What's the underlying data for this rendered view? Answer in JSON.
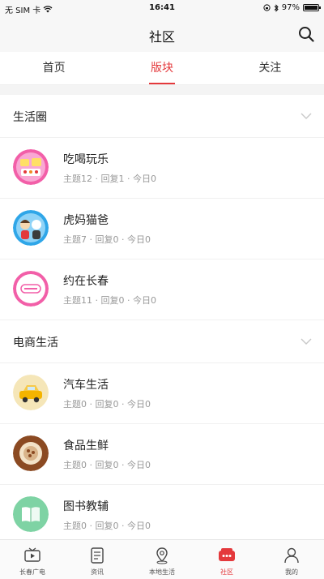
{
  "status_bar": {
    "carrier": "无 SIM 卡",
    "time": "16:41",
    "battery": "97%",
    "battery_level": 0.97
  },
  "nav": {
    "title": "社区"
  },
  "top_tabs": [
    {
      "label": "首页",
      "active": false
    },
    {
      "label": "版块",
      "active": true
    },
    {
      "label": "关注",
      "active": false
    }
  ],
  "sections": [
    {
      "title": "生活圈",
      "items": [
        {
          "name": "吃喝玩乐",
          "meta": "主题12 · 回复1 · 今日0",
          "avatar": "food-fun"
        },
        {
          "name": "虎妈猫爸",
          "meta": "主题7 · 回复0 · 今日0",
          "avatar": "parents"
        },
        {
          "name": "约在长春",
          "meta": "主题11 · 回复0 · 今日0",
          "avatar": "meetup"
        }
      ]
    },
    {
      "title": "电商生活",
      "items": [
        {
          "name": "汽车生活",
          "meta": "主题0 · 回复0 · 今日0",
          "avatar": "car"
        },
        {
          "name": "食品生鲜",
          "meta": "主题0 · 回复0 · 今日0",
          "avatar": "food"
        },
        {
          "name": "图书教辅",
          "meta": "主题0 · 回复0 · 今日0",
          "avatar": "books"
        }
      ]
    }
  ],
  "bottom_tabs": [
    {
      "label": "长春广电",
      "icon": "tv-icon",
      "active": false
    },
    {
      "label": "资讯",
      "icon": "news-icon",
      "active": false
    },
    {
      "label": "本地生活",
      "icon": "local-life-icon",
      "active": false
    },
    {
      "label": "社区",
      "icon": "community-icon",
      "active": true
    },
    {
      "label": "我的",
      "icon": "profile-icon",
      "active": false
    }
  ],
  "colors": {
    "accent": "#e4393c",
    "text_secondary": "#999999"
  }
}
